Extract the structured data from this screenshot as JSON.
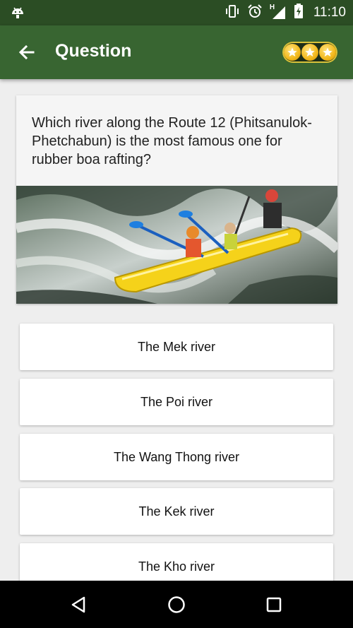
{
  "status_bar": {
    "time": "11:10",
    "icons": [
      "android-debug-icon",
      "vibrate-icon",
      "alarm-icon",
      "signal-h-icon",
      "battery-charging-icon"
    ],
    "network_label": "H"
  },
  "app_bar": {
    "title": "Question",
    "back_icon": "arrow-left-icon",
    "stars": 3,
    "colors": {
      "status": "#2b4d24",
      "toolbar": "#386531"
    }
  },
  "question": {
    "text": "Which river along the Route 12 (Phitsanulok-Phetchabun) is the most famous one for rubber boa rafting?",
    "image": "kayak-rafting-photo"
  },
  "answers": [
    {
      "label": "The Mek river"
    },
    {
      "label": "The Poi river"
    },
    {
      "label": "The Wang Thong river"
    },
    {
      "label": "The Kek river"
    },
    {
      "label": "The Kho river"
    }
  ],
  "nav_bar": {
    "buttons": [
      "back-triangle-icon",
      "home-circle-icon",
      "recents-square-icon"
    ]
  }
}
